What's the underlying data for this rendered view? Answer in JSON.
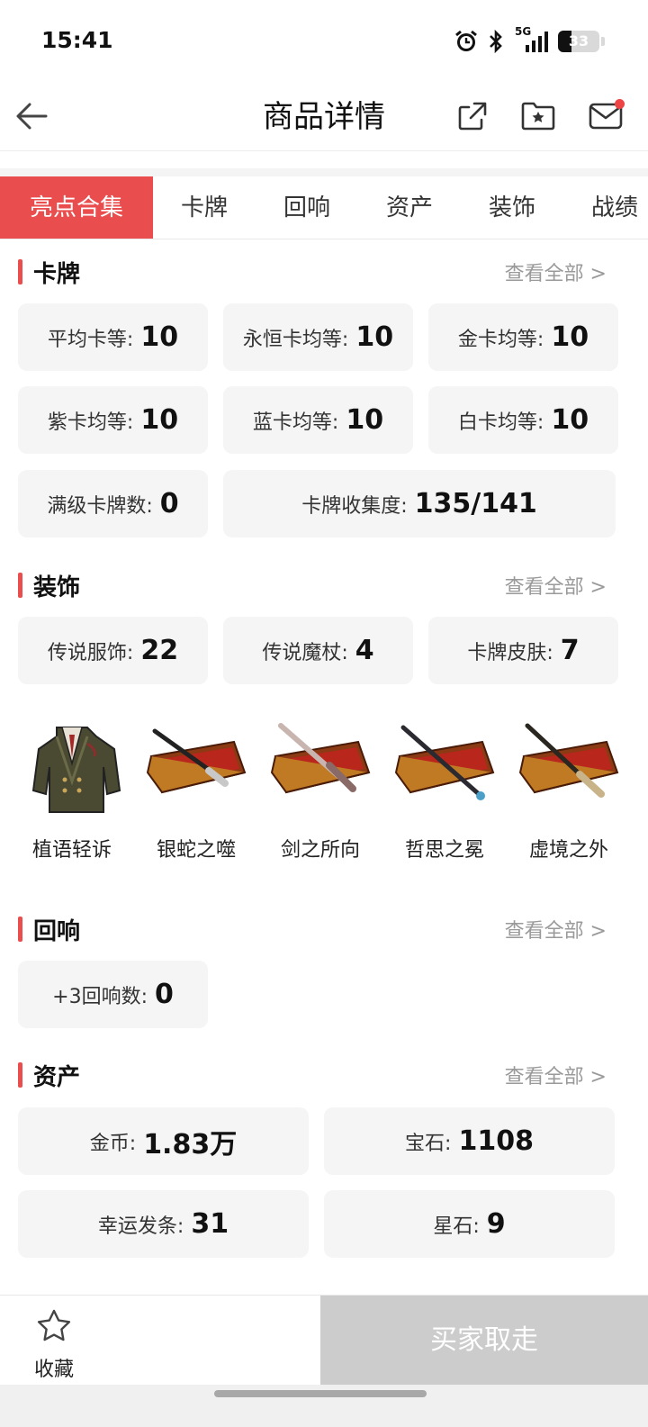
{
  "status_bar": {
    "time": "15:41",
    "network": "5G",
    "battery": "33",
    "battery_level": 0.33,
    "icons": [
      "alarm-icon",
      "bluetooth-icon",
      "signal-5g-icon",
      "battery-icon"
    ]
  },
  "header": {
    "title": "商品详情",
    "icons": [
      "back-arrow-icon",
      "share-icon",
      "favorite-folder-icon",
      "mail-icon"
    ]
  },
  "tabs": [
    {
      "label": "亮点合集",
      "active": true
    },
    {
      "label": "卡牌",
      "active": false
    },
    {
      "label": "回响",
      "active": false
    },
    {
      "label": "资产",
      "active": false
    },
    {
      "label": "装饰",
      "active": false
    },
    {
      "label": "战绩",
      "active": false
    }
  ],
  "sections": {
    "cards": {
      "title": "卡牌",
      "more": "查看全部 >",
      "stats": [
        {
          "label": "平均卡等:",
          "value": "10"
        },
        {
          "label": "永恒卡均等:",
          "value": "10"
        },
        {
          "label": "金卡均等:",
          "value": "10"
        },
        {
          "label": "紫卡均等:",
          "value": "10"
        },
        {
          "label": "蓝卡均等:",
          "value": "10"
        },
        {
          "label": "白卡均等:",
          "value": "10"
        },
        {
          "label": "满级卡牌数:",
          "value": "0"
        },
        {
          "label": "卡牌收集度:",
          "value": "135/141"
        }
      ]
    },
    "decor": {
      "title": "装饰",
      "more": "查看全部 >",
      "stats": [
        {
          "label": "传说服饰:",
          "value": "22"
        },
        {
          "label": "传说魔杖:",
          "value": "4"
        },
        {
          "label": "卡牌皮肤:",
          "value": "7"
        }
      ],
      "items": [
        {
          "name": "植语轻诉",
          "icon": "jacket-icon"
        },
        {
          "name": "银蛇之噬",
          "icon": "wand-case-icon"
        },
        {
          "name": "剑之所向",
          "icon": "wand-case-icon"
        },
        {
          "name": "哲思之冕",
          "icon": "wand-case-icon"
        },
        {
          "name": "虚境之外",
          "icon": "wand-case-icon"
        }
      ]
    },
    "echo": {
      "title": "回响",
      "more": "查看全部 >",
      "stats": [
        {
          "label": "+3回响数:",
          "value": "0"
        }
      ]
    },
    "assets": {
      "title": "资产",
      "more": "查看全部 >",
      "stats": [
        {
          "label": "金币:",
          "value": "1.83万"
        },
        {
          "label": "宝石:",
          "value": "1108"
        },
        {
          "label": "幸运发条:",
          "value": "31"
        },
        {
          "label": "星石:",
          "value": "9"
        }
      ]
    }
  },
  "bottom_bar": {
    "favorite_label": "收藏",
    "buy_label": "买家取走"
  },
  "colors": {
    "accent": "#EA4D4D",
    "card_bg": "#F5F5F5",
    "disabled_button": "#CCCCCC"
  }
}
